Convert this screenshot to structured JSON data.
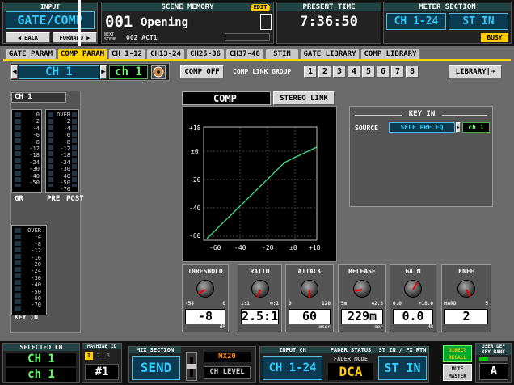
{
  "header": {
    "input_title": "INPUT",
    "screen_name": "GATE/COMP",
    "back": "◀ BACK",
    "forward": "FORWARD ▶",
    "scene_memory_title": "SCENE MEMORY",
    "edit_badge": "EDIT",
    "scene_number": "001",
    "scene_name": "Opening",
    "next_label": "NEXT SCENE",
    "next_scene": "002 ACT1",
    "present_time_title": "PRESENT TIME",
    "present_time": "7:36:50",
    "meter_section_title": "METER SECTION",
    "meter_ch": "CH 1-24",
    "meter_stin": "ST IN",
    "busy": "BUSY"
  },
  "tabs": [
    {
      "label": "GATE PARAM",
      "active": false
    },
    {
      "label": "COMP PARAM",
      "active": true
    },
    {
      "label": "CH 1-12",
      "active": false
    },
    {
      "label": "CH13-24",
      "active": false
    },
    {
      "label": "CH25-36",
      "active": false
    },
    {
      "label": "CH37-48",
      "active": false
    },
    {
      "label": "STIN",
      "active": false
    },
    {
      "label": "GATE LIBRARY",
      "active": false
    },
    {
      "label": "COMP LIBRARY",
      "active": false
    }
  ],
  "channel": {
    "lcd": "CH 1",
    "name": "ch 1",
    "panel_label": "CH 1"
  },
  "comp_off": "COMP OFF",
  "comp_link_group": {
    "label": "COMP LINK GROUP",
    "buttons": [
      "1",
      "2",
      "3",
      "4",
      "5",
      "6",
      "7",
      "8"
    ]
  },
  "library_button": "LIBRARY|➔",
  "comp_title": "COMP",
  "stereo_link": "STEREO LINK",
  "key_in": {
    "title": "KEY IN",
    "source_label": "SOURCE",
    "source_value": "SELF PRE EQ",
    "source_ch": "ch 1"
  },
  "meters": {
    "scale_top": [
      "0",
      "-2",
      "-4",
      "-6",
      "-8",
      "-12",
      "-18",
      "-24",
      "-30",
      "-40",
      "-50"
    ],
    "scale_over": [
      "OVER",
      "-2",
      "-4",
      "-6",
      "-8",
      "-12",
      "-18",
      "-24",
      "-30",
      "-40",
      "-50",
      "-70"
    ],
    "gr_label": "GR",
    "pre_label": "PRE",
    "post_label": "POST",
    "key_in_label": "KEY IN",
    "scale_keyin": [
      "OVER",
      "-4",
      "-8",
      "-12",
      "-16",
      "-20",
      "-24",
      "-30",
      "-40",
      "-50",
      "-60",
      "-70"
    ]
  },
  "graph": {
    "y_ticks": [
      "+18",
      "±0",
      "-20",
      "-40",
      "-60"
    ],
    "x_ticks": [
      "-60",
      "-40",
      "-20",
      "±0",
      "+18"
    ]
  },
  "params": [
    {
      "name": "THRESHOLD",
      "min": "-54",
      "max": "0",
      "value": "-8",
      "unit": "dB"
    },
    {
      "name": "RATIO",
      "min": "1:1",
      "max": "∞:1",
      "value": "2.5:1",
      "unit": ""
    },
    {
      "name": "ATTACK",
      "min": "0",
      "max": "120",
      "value": "60",
      "unit": "msec"
    },
    {
      "name": "RELEASE",
      "min": "5m",
      "max": "42.3",
      "value": "229m",
      "unit": "sec"
    },
    {
      "name": "GAIN",
      "min": "0.0",
      "max": "+18.0",
      "value": "0.0",
      "unit": "dB"
    },
    {
      "name": "KNEE",
      "min": "HARD",
      "max": "5",
      "value": "2",
      "unit": ""
    }
  ],
  "footer": {
    "selected_ch_title": "SELECTED CH",
    "selected_ch": "CH 1",
    "selected_name": "ch 1",
    "machine_id_title": "MACHINE ID",
    "machine_ids": [
      "1",
      "2",
      "3"
    ],
    "machine_id": "#1",
    "mix_section_title": "MIX SECTION",
    "send": "SEND",
    "mix_name": "MX20",
    "ch_level": "CH LEVEL",
    "input_ch_title": "INPUT CH",
    "input_ch": "CH 1-24",
    "fader_status_title": "FADER STATUS",
    "fader_mode_title": "FADER MODE",
    "fader_mode": "DCA",
    "stin_title": "ST IN / FX RTN",
    "stin": "ST IN",
    "direct_recall": "DIRECT RECALL",
    "mute_master": "MUTE MASTER",
    "user_def_title": "USER DEF KEY BANK",
    "user_def": "A"
  },
  "colors": {
    "panel": "#6b6b6b",
    "active_tab": "#ffd400",
    "lcd_text": "#33ccff",
    "graph_line": "#40e080"
  }
}
